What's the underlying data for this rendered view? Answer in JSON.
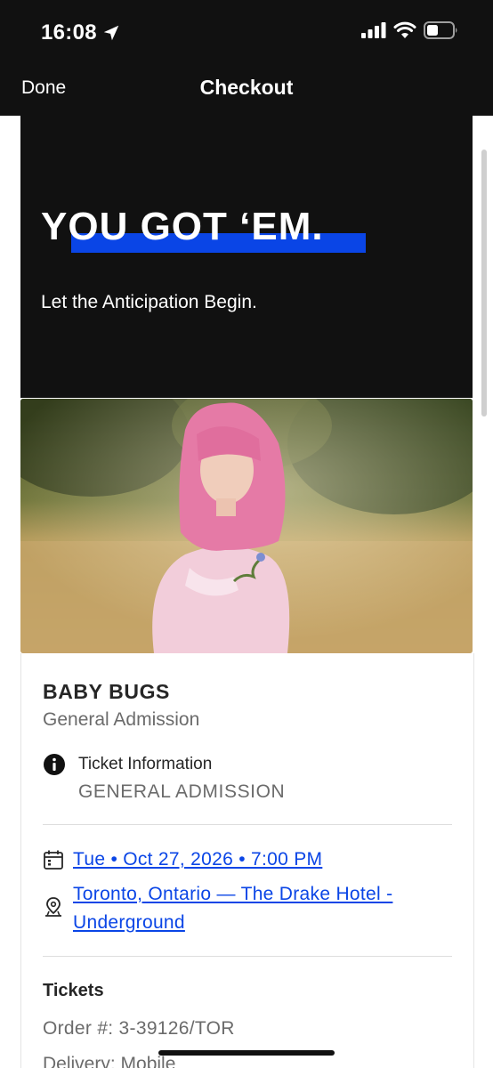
{
  "status_bar": {
    "time": "16:08"
  },
  "nav": {
    "done_label": "Done",
    "title": "Checkout"
  },
  "hero": {
    "headline": "YOU GOT ‘EM.",
    "subtitle": "Let the Anticipation Begin.",
    "accent_color": "#0a45e6"
  },
  "event": {
    "name": "BABY BUGS",
    "tier": "General Admission",
    "ticket_info_label": "Ticket Information",
    "ticket_info_value": "GENERAL ADMISSION",
    "date_time": "Tue • Oct 27, 2026 • 7:00 PM",
    "venue": "Toronto, Ontario — The Drake Hotel - Underground"
  },
  "tickets": {
    "title": "Tickets",
    "order_number": "Order #: 3-39126/TOR",
    "delivery": "Delivery: Mobile"
  },
  "icons": [
    "location-arrow-icon",
    "signal-icon",
    "wifi-icon",
    "battery-icon",
    "info-icon",
    "calendar-icon",
    "map-pin-icon"
  ],
  "colors": {
    "link": "#0a45e6",
    "dark_background": "#111111"
  }
}
